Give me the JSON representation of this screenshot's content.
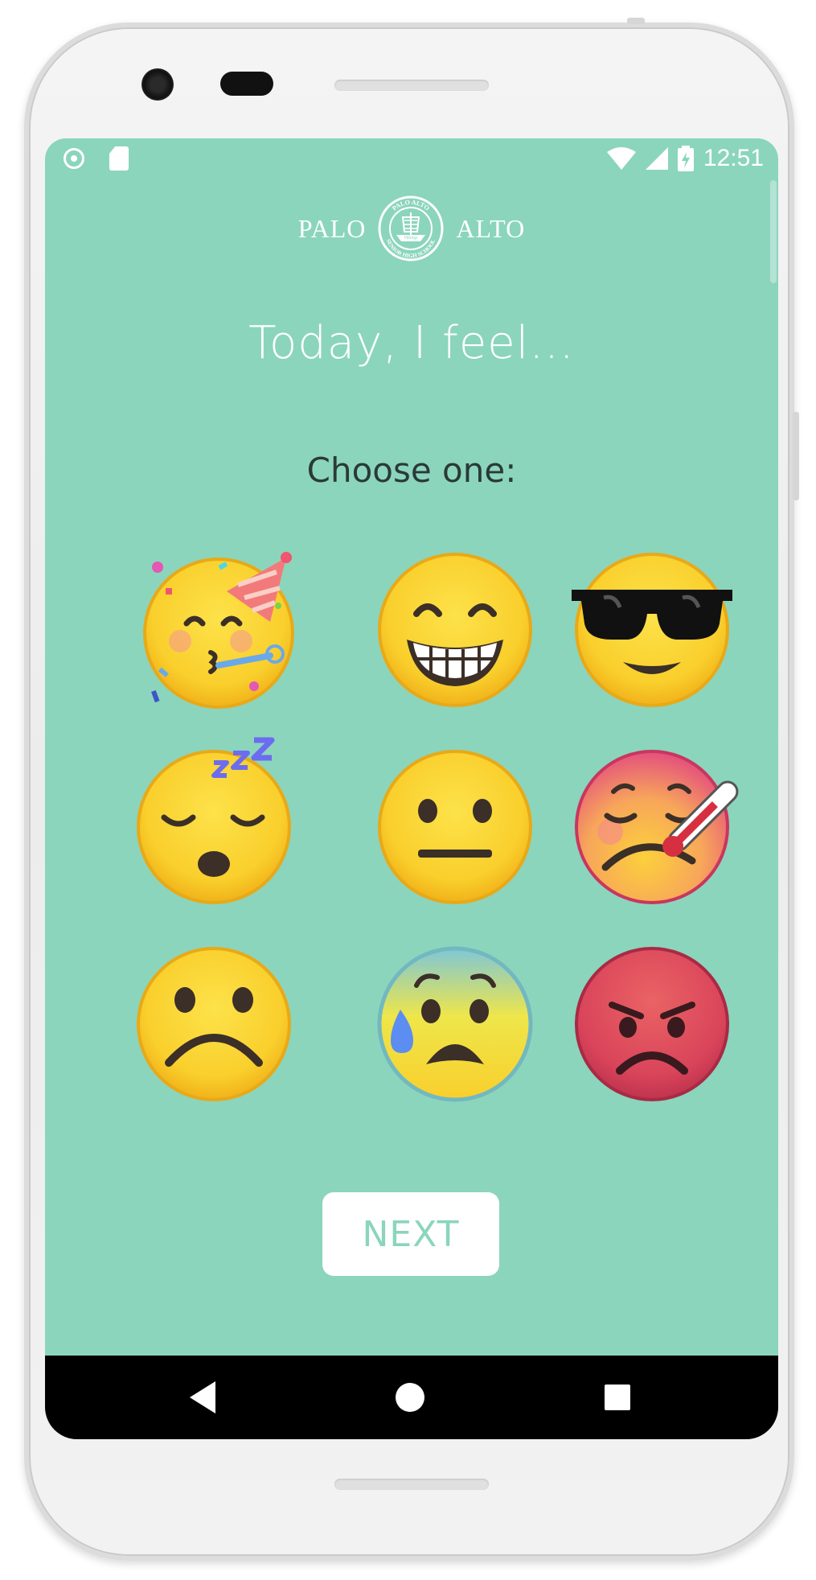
{
  "status_bar": {
    "time": "12:51",
    "left_icons": [
      "record-icon",
      "sd-card-icon"
    ],
    "right_icons": [
      "wifi-icon",
      "cell-signal-icon",
      "battery-charging-icon"
    ]
  },
  "header": {
    "logo_left": "PALO",
    "logo_right": "ALTO",
    "seal_top": "PALO ALTO",
    "seal_bottom": "SENIOR HIGH SCHOOL",
    "seal_center": "Vikings"
  },
  "title": "Today, I feel...",
  "subtitle": "Choose one:",
  "emojis": [
    {
      "name": "partying-face-emoji",
      "icon": "partying-face"
    },
    {
      "name": "grinning-face-emoji",
      "icon": "grinning-squinting"
    },
    {
      "name": "sunglasses-face-emoji",
      "icon": "smiling-face-with-sunglasses"
    },
    {
      "name": "sleeping-face-emoji",
      "icon": "sleeping-face"
    },
    {
      "name": "neutral-face-emoji",
      "icon": "neutral-face"
    },
    {
      "name": "sick-face-emoji",
      "icon": "face-with-thermometer"
    },
    {
      "name": "frowning-face-emoji",
      "icon": "frowning-face"
    },
    {
      "name": "anxious-face-emoji",
      "icon": "anxious-face-with-sweat"
    },
    {
      "name": "angry-face-emoji",
      "icon": "pouting-face"
    }
  ],
  "next_button": {
    "label": "NEXT"
  },
  "nav_bar": {
    "icons": [
      "back-icon",
      "home-icon",
      "recents-icon"
    ]
  },
  "colors": {
    "screen_background": "#8bd5bd",
    "button_background": "#ffffff",
    "button_text": "#8bd5bd",
    "emoji_yellow": "#fbd536",
    "angry_red": "#d9445a"
  }
}
